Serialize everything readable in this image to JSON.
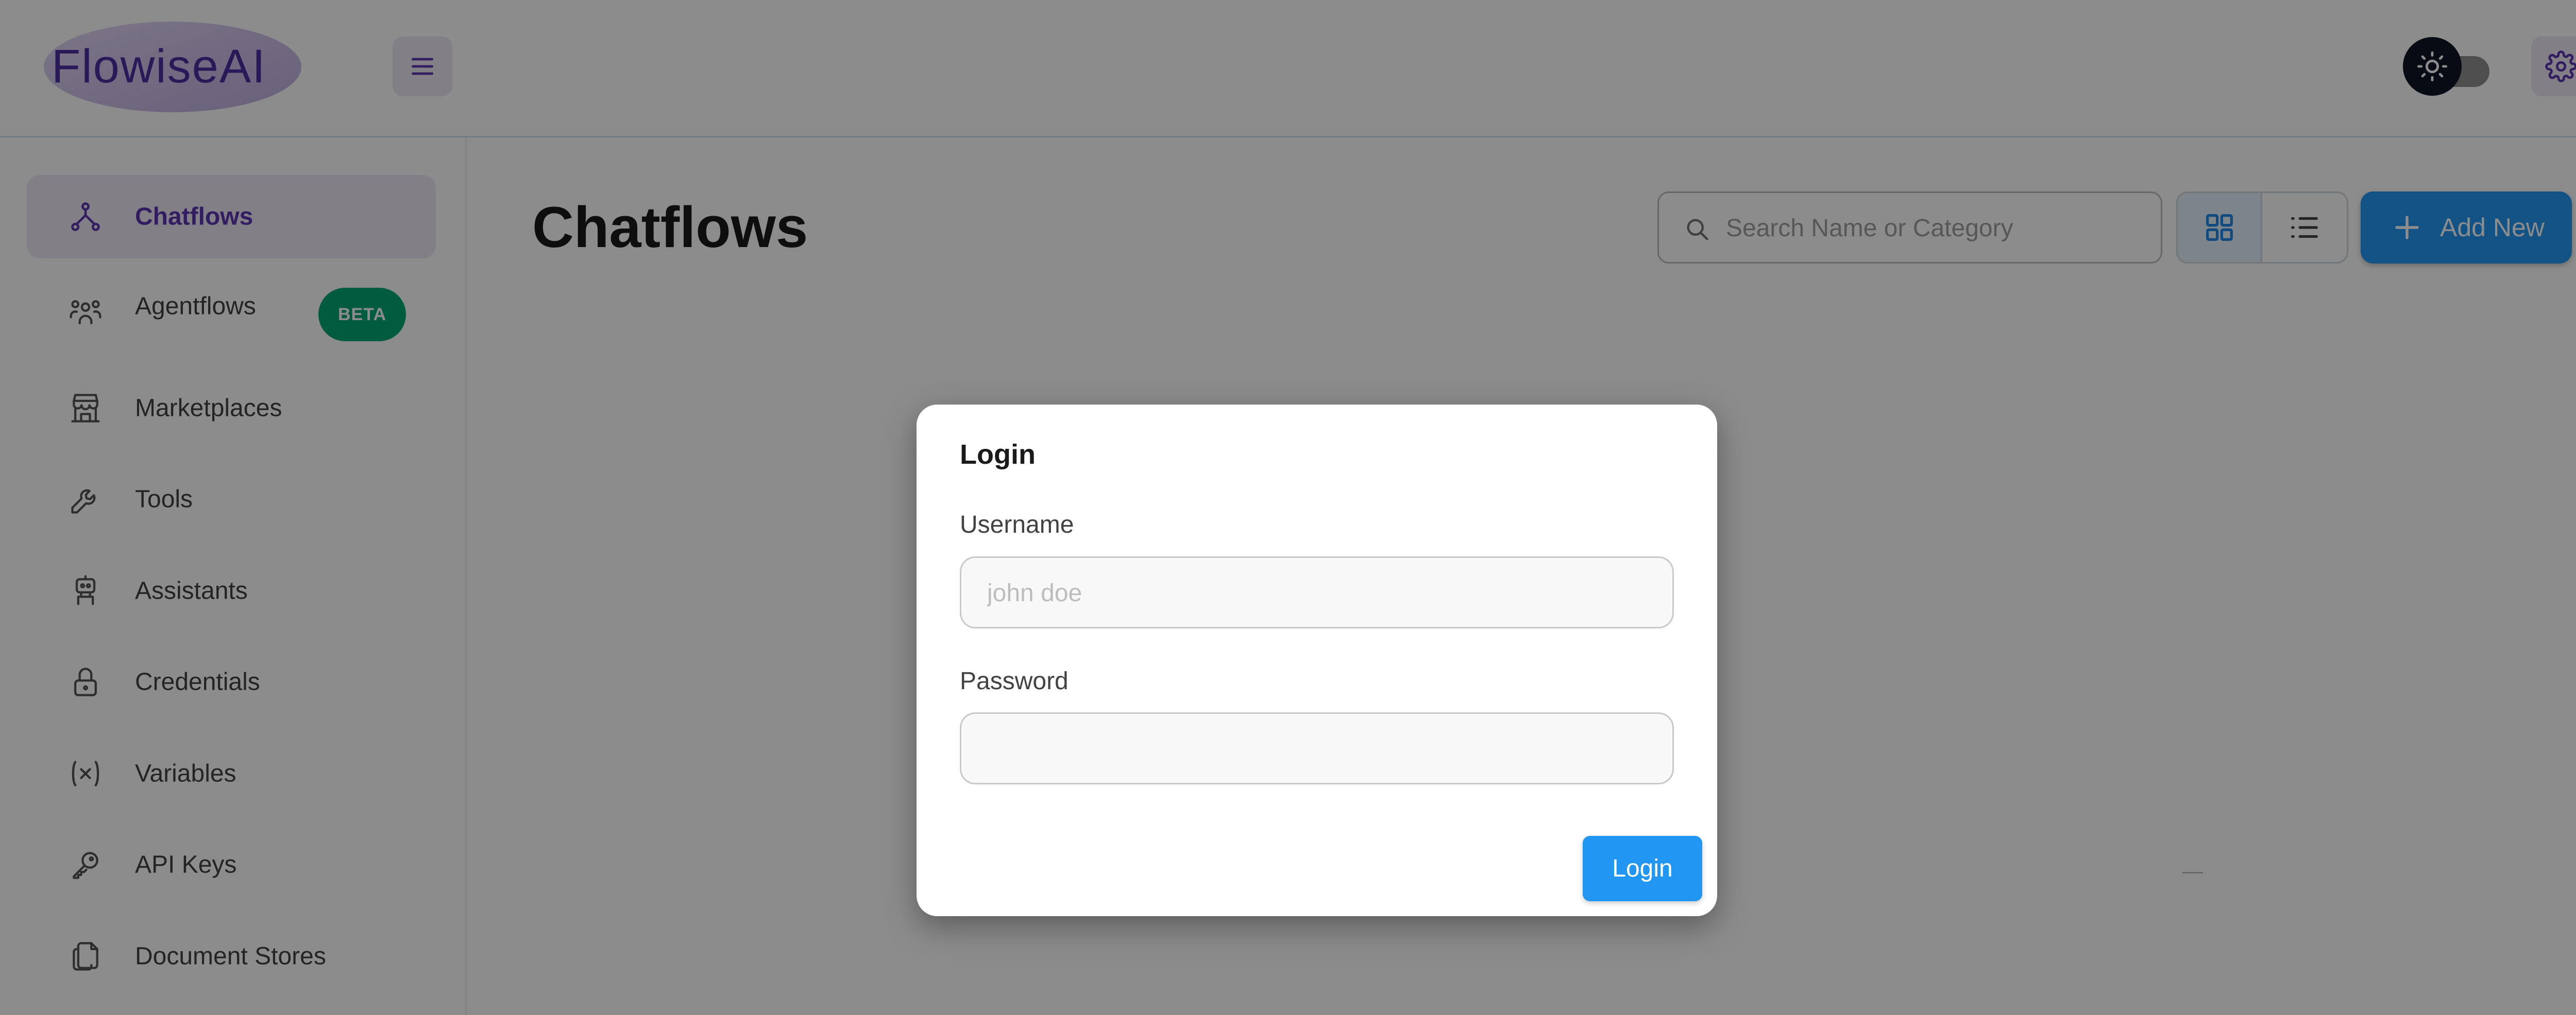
{
  "app": {
    "logo_text": "FlowiseAI"
  },
  "header": {
    "menu_icon": "hamburger-icon",
    "theme_toggle_icon": "sun-icon",
    "settings_icon": "gear-icon"
  },
  "sidebar": {
    "items": [
      {
        "label": "Chatflows",
        "icon": "flow-icon",
        "active": true
      },
      {
        "label": "Agentflows",
        "icon": "users-group-icon",
        "badge": "BETA"
      },
      {
        "label": "Marketplaces",
        "icon": "storefront-icon"
      },
      {
        "label": "Tools",
        "icon": "wrench-icon"
      },
      {
        "label": "Assistants",
        "icon": "robot-icon"
      },
      {
        "label": "Credentials",
        "icon": "lock-icon"
      },
      {
        "label": "Variables",
        "icon": "variable-icon"
      },
      {
        "label": "API Keys",
        "icon": "key-icon"
      },
      {
        "label": "Document Stores",
        "icon": "files-icon"
      }
    ]
  },
  "main": {
    "title": "Chatflows",
    "search": {
      "placeholder": "Search Name or Category",
      "value": ""
    },
    "view_toggle": {
      "selected": "grid"
    },
    "add_button_label": "Add New"
  },
  "dialog": {
    "title": "Login",
    "username": {
      "label": "Username",
      "placeholder": "john doe",
      "value": ""
    },
    "password": {
      "label": "Password",
      "value": ""
    },
    "submit_label": "Login"
  },
  "colors": {
    "accent": "#5e35b1",
    "primary": "#2196f3",
    "beta": "#00a774",
    "active_bg": "#ede7f6"
  }
}
